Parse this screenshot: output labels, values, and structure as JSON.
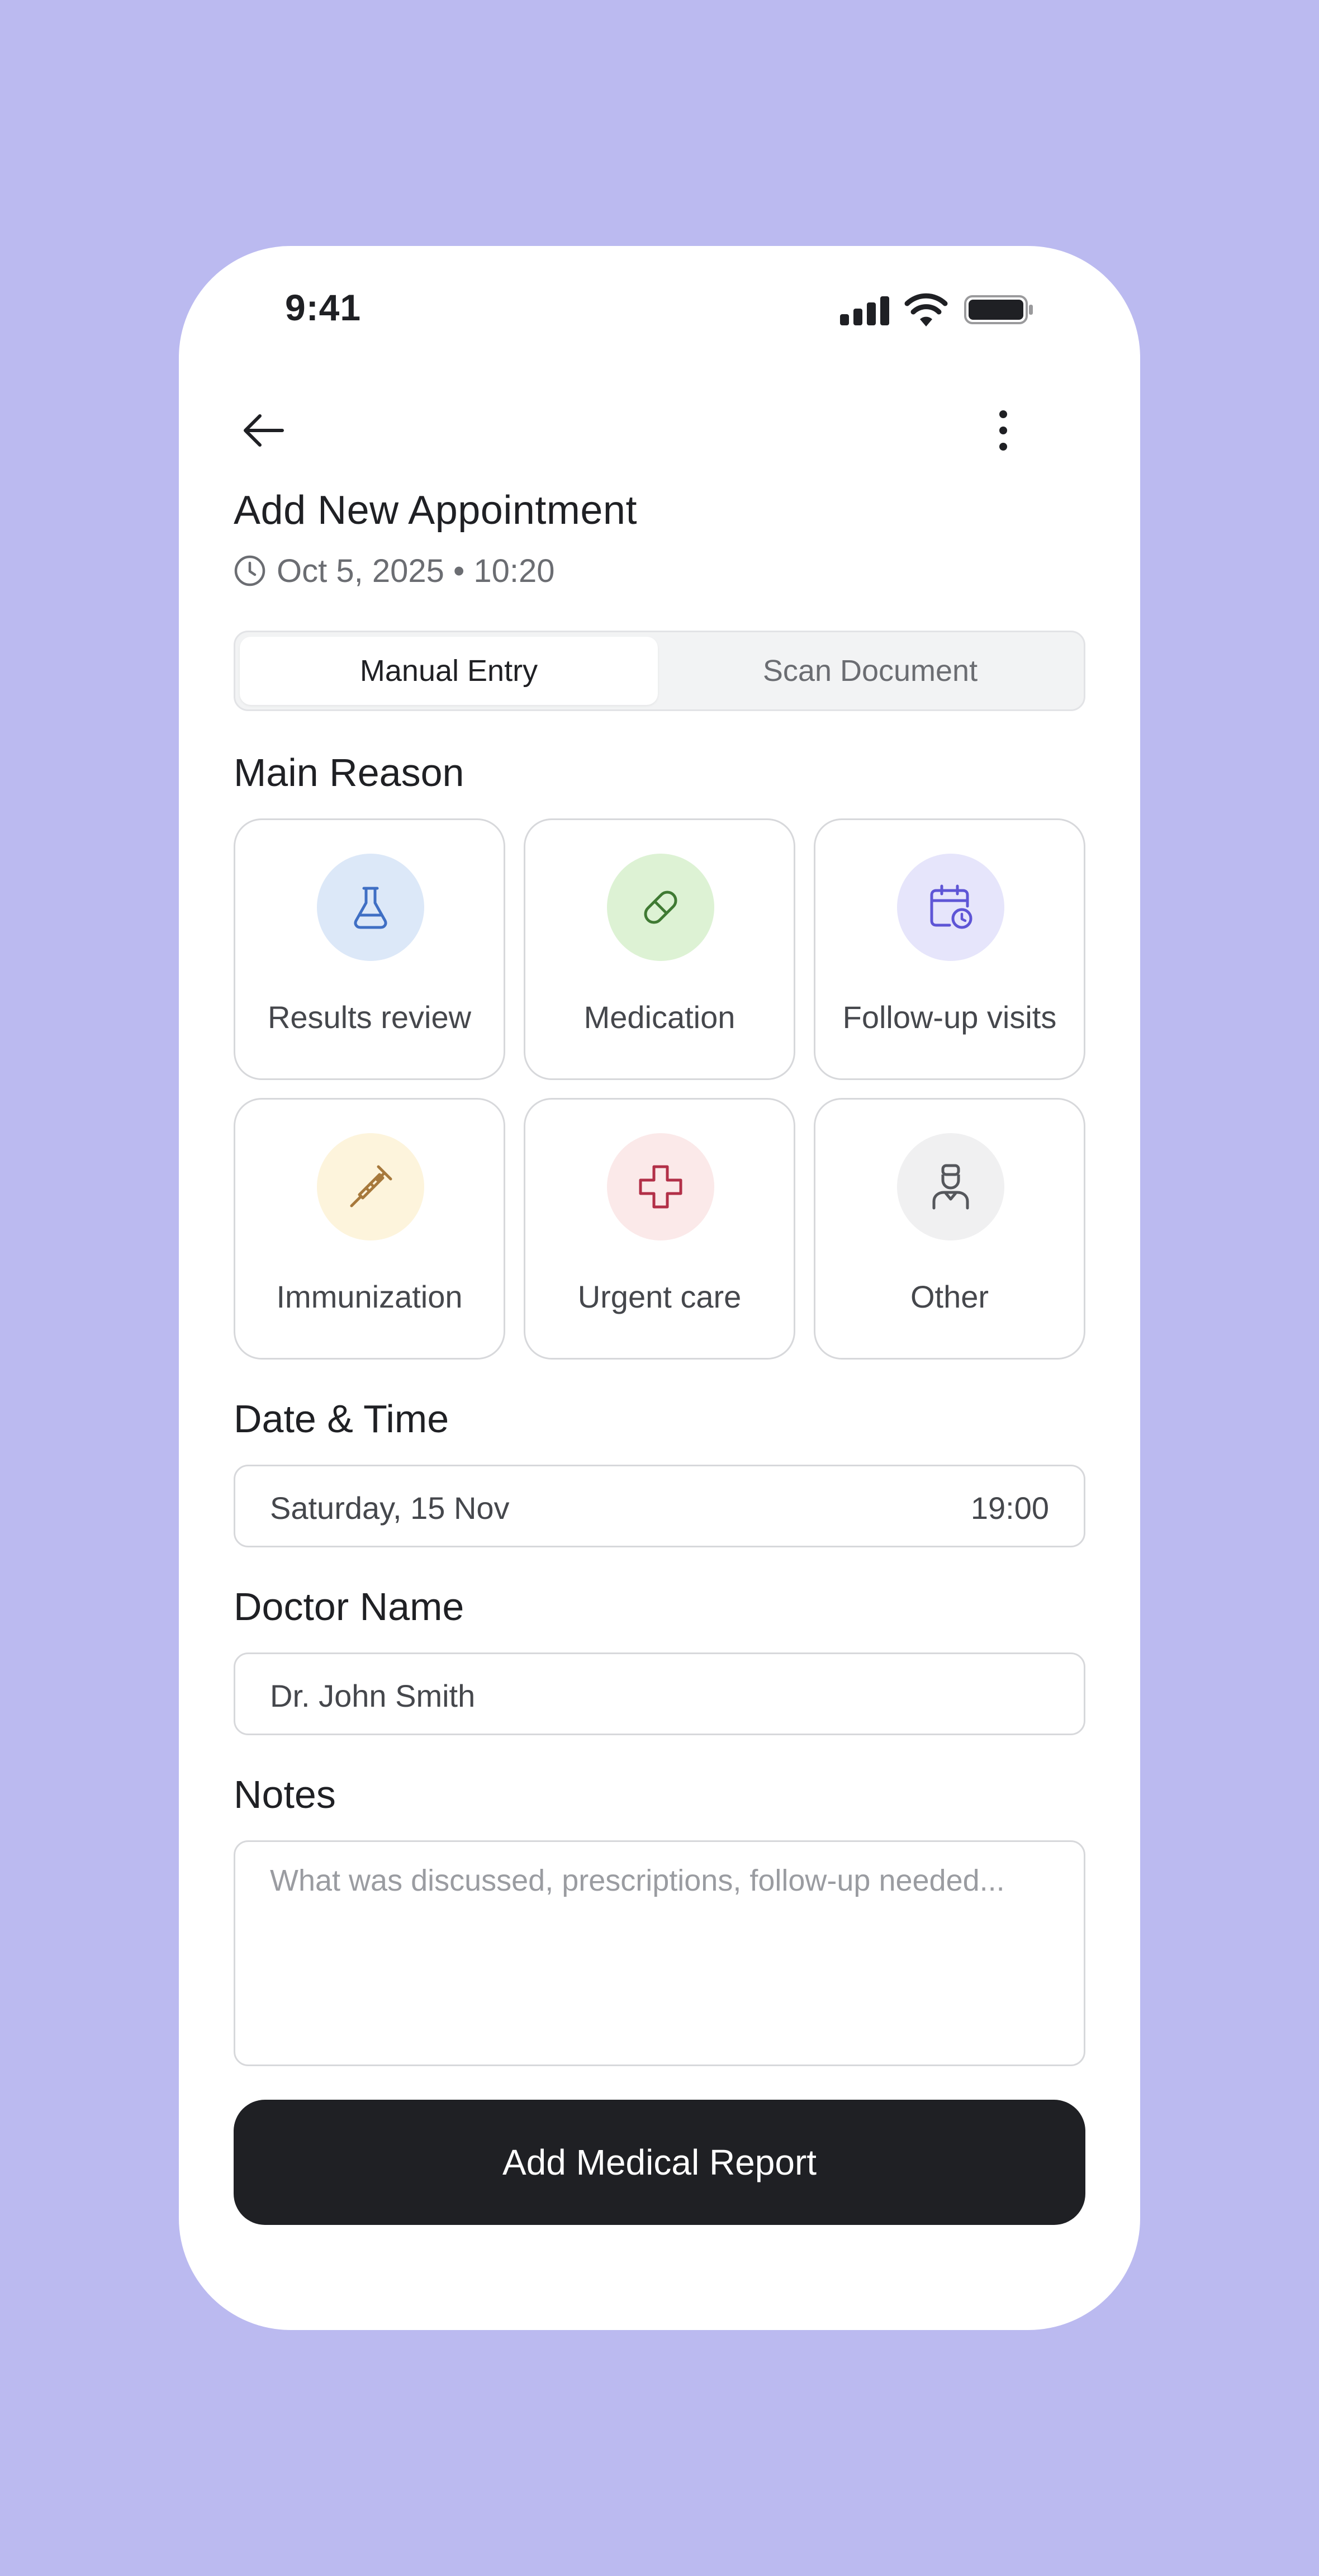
{
  "status_bar": {
    "time": "9:41"
  },
  "header": {
    "title": "Add New Appointment",
    "datetime": "Oct 5, 2025 • 10:20"
  },
  "tabs": [
    {
      "label": "Manual Entry",
      "active": true
    },
    {
      "label": "Scan Document",
      "active": false
    }
  ],
  "main_reason": {
    "label": "Main Reason",
    "options": [
      {
        "label": "Results review",
        "icon": "flask-icon",
        "bg": "#DCE8F8",
        "color": "#3F6FC4"
      },
      {
        "label": "Medication",
        "icon": "pill-icon",
        "bg": "#DDF2D4",
        "color": "#3F7A33"
      },
      {
        "label": "Follow-up visits",
        "icon": "calendar-clock-icon",
        "bg": "#E6E5FB",
        "color": "#5E55D6"
      },
      {
        "label": "Immunization",
        "icon": "syringe-icon",
        "bg": "#FDF4DC",
        "color": "#A7793C"
      },
      {
        "label": "Urgent care",
        "icon": "medical-cross-icon",
        "bg": "#FBE9E9",
        "color": "#B23048"
      },
      {
        "label": "Other",
        "icon": "doctor-icon",
        "bg": "#F0F0F1",
        "color": "#55575C"
      }
    ]
  },
  "date_time": {
    "label": "Date & Time",
    "date": "Saturday, 15 Nov",
    "time": "19:00"
  },
  "doctor": {
    "label": "Doctor Name",
    "value": "Dr. John Smith"
  },
  "notes": {
    "label": "Notes",
    "placeholder": "What was discussed, prescriptions, follow-up needed..."
  },
  "submit_label": "Add Medical Report",
  "colors": {
    "background": "#BBBAF0",
    "button": "#1F2024"
  }
}
